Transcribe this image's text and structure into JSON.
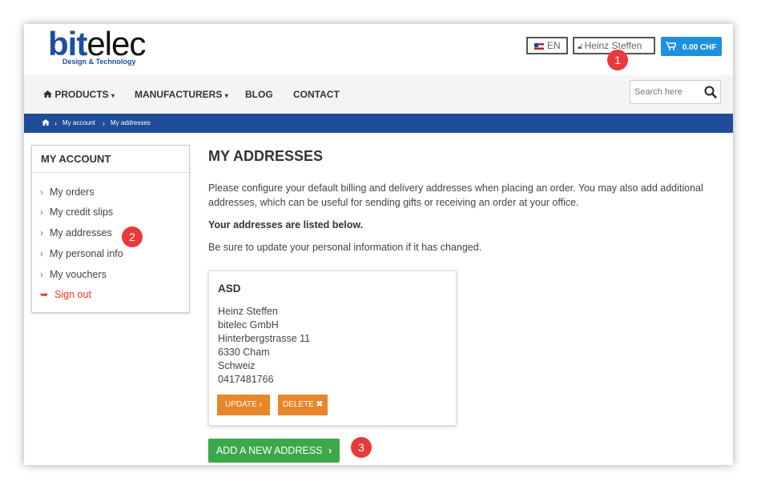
{
  "logo": {
    "word_blue": "bit",
    "word_dark": "elec",
    "tagline": "Design & Technology"
  },
  "header": {
    "language": "EN",
    "user": "Heinz Steffen",
    "cart": "0.00 CHF"
  },
  "nav": {
    "items": [
      {
        "label": "PRODUCTS",
        "dropdown": true
      },
      {
        "label": "MANUFACTURERS",
        "dropdown": true
      },
      {
        "label": "BLOG",
        "dropdown": false
      },
      {
        "label": "CONTACT",
        "dropdown": false
      }
    ],
    "search_placeholder": "Search here"
  },
  "breadcrumb": {
    "items": [
      "My account",
      "My addresses"
    ]
  },
  "sidebar": {
    "title": "MY ACCOUNT",
    "items": [
      "My orders",
      "My credit slips",
      "My addresses",
      "My personal info",
      "My vouchers"
    ],
    "signout": "Sign out"
  },
  "main": {
    "title": "MY ADDRESSES",
    "intro": "Please configure your default billing and delivery addresses when placing an order. You may also add additional addresses, which can be useful for sending gifts or receiving an order at your office.",
    "listed": "Your addresses are listed below.",
    "update_note": "Be sure to update your personal information if it has changed."
  },
  "address": {
    "alias": "ASD",
    "name": "Heinz Steffen",
    "company": "bitelec GmbH",
    "street": "Hinterbergstrasse 11",
    "city": "6330 Cham",
    "country": "Schweiz",
    "phone": "0417481766",
    "update_label": "UPDATE",
    "delete_label": "DELETE"
  },
  "add_address_label": "ADD A NEW ADDRESS",
  "callouts": [
    "1",
    "2",
    "3"
  ],
  "colors": {
    "brand_blue": "#1d4fa3",
    "breadcrumb_bar": "#1e4c9a",
    "cart_button": "#1e90e0",
    "action_orange": "#e8862a",
    "add_green": "#3ca84a",
    "signout_red": "#e33322",
    "callout_red": "#e83a3a"
  },
  "icons": [
    "flag-us-icon",
    "lock-icon",
    "cart-icon",
    "home-icon",
    "search-icon",
    "chevron-right-icon",
    "signout-icon",
    "close-icon",
    "caret-down-icon"
  ]
}
